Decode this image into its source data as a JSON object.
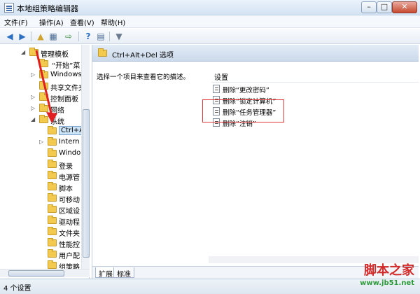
{
  "window": {
    "title": "本地组策略编辑器",
    "controls": {
      "minimize": "–",
      "maximize": "□",
      "close": "✕"
    }
  },
  "menu": [
    "文件(F)",
    "操作(A)",
    "查看(V)",
    "帮助(H)"
  ],
  "toolbar": {
    "icons": [
      "back-arrow-icon",
      "forward-arrow-icon",
      "up-folder-icon",
      "show-tree-icon",
      "export-list-icon",
      "help-icon",
      "properties-icon",
      "filter-icon"
    ]
  },
  "tree": {
    "items": [
      {
        "label": "管理模板",
        "level": 0,
        "expanded": true
      },
      {
        "label": "“开始”菜",
        "level": 1
      },
      {
        "label": "Windows",
        "level": 1
      },
      {
        "label": "共享文件夹",
        "level": 1
      },
      {
        "label": "控制面板",
        "level": 1
      },
      {
        "label": "网络",
        "level": 1
      },
      {
        "label": "系统",
        "level": 1,
        "expanded": true
      },
      {
        "label": "Ctrl+A",
        "level": 2,
        "selected": true
      },
      {
        "label": "Intern",
        "level": 2
      },
      {
        "label": "Windo",
        "level": 2
      },
      {
        "label": "登录",
        "level": 2
      },
      {
        "label": "电源管",
        "level": 2
      },
      {
        "label": "脚本",
        "level": 2
      },
      {
        "label": "可移动",
        "level": 2
      },
      {
        "label": "区域设",
        "level": 2
      },
      {
        "label": "驱动程",
        "level": 2
      },
      {
        "label": "文件夹",
        "level": 2
      },
      {
        "label": "性能控",
        "level": 2
      },
      {
        "label": "用户配",
        "level": 2
      },
      {
        "label": "组策略",
        "level": 2
      }
    ]
  },
  "right": {
    "header": "Ctrl+Alt+Del 选项",
    "description": "选择一个项目来查看它的描述。",
    "column_header": "设置",
    "settings": [
      "删除“更改密码”",
      "删除“锁定计算机”",
      "删除“任务管理器”",
      "删除“注销”"
    ],
    "highlighted_index": 2,
    "tabs": [
      "扩展",
      "标准"
    ],
    "active_tab": 0
  },
  "statusbar": {
    "text": "4 个设置"
  },
  "watermark": {
    "line1": "脚本之家",
    "line2": "www.jb51.net"
  }
}
